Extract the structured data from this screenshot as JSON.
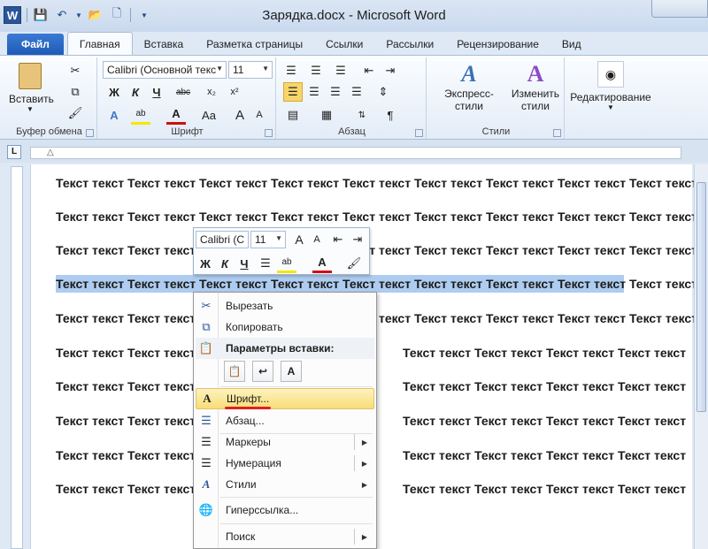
{
  "window": {
    "title": "Зарядка.docx - Microsoft Word",
    "app_icon": "W"
  },
  "tabs": [
    {
      "label": "Файл"
    },
    {
      "label": "Главная"
    },
    {
      "label": "Вставка"
    },
    {
      "label": "Разметка страницы"
    },
    {
      "label": "Ссылки"
    },
    {
      "label": "Рассылки"
    },
    {
      "label": "Рецензирование"
    },
    {
      "label": "Вид"
    }
  ],
  "ribbon": {
    "clipboard": {
      "paste_label": "Вставить",
      "group_label": "Буфер обмена"
    },
    "font": {
      "font_name": "Calibri (Основной текс",
      "font_size": "11",
      "group_label": "Шрифт",
      "bold": "Ж",
      "italic": "К",
      "underline": "Ч",
      "grow": "A",
      "case": "Aa"
    },
    "paragraph": {
      "group_label": "Абзац"
    },
    "styles": {
      "express_label": "Экспресс-стили",
      "change_label_1": "Изменить",
      "change_label_2": "стили",
      "group_label": "Стили"
    },
    "editing": {
      "label": "Редактирование"
    }
  },
  "document": {
    "line_text": "Текст текст Текст текст Текст текст Текст текст Текст текст Текст текст Текст текст Текст текст Текст текст",
    "left_fragment": "Текст текст Текст текст",
    "right_fragment": "Текст текст Текст текст Текст текст Текст текст"
  },
  "mini_toolbar": {
    "font_name": "Calibri (С",
    "font_size": "11"
  },
  "context_menu": {
    "cut": "Вырезать",
    "copy": "Копировать",
    "paste_options": "Параметры вставки:",
    "font": "Шрифт...",
    "paragraph": "Абзац...",
    "bullets": "Маркеры",
    "numbering": "Нумерация",
    "styles": "Стили",
    "hyperlink": "Гиперссылка...",
    "search": "Поиск"
  },
  "colors": {
    "accent_blue": "#2a5699",
    "selection": "#aeccf0",
    "highlight_menu": "#f8dc75",
    "underline_red": "#e02020"
  }
}
